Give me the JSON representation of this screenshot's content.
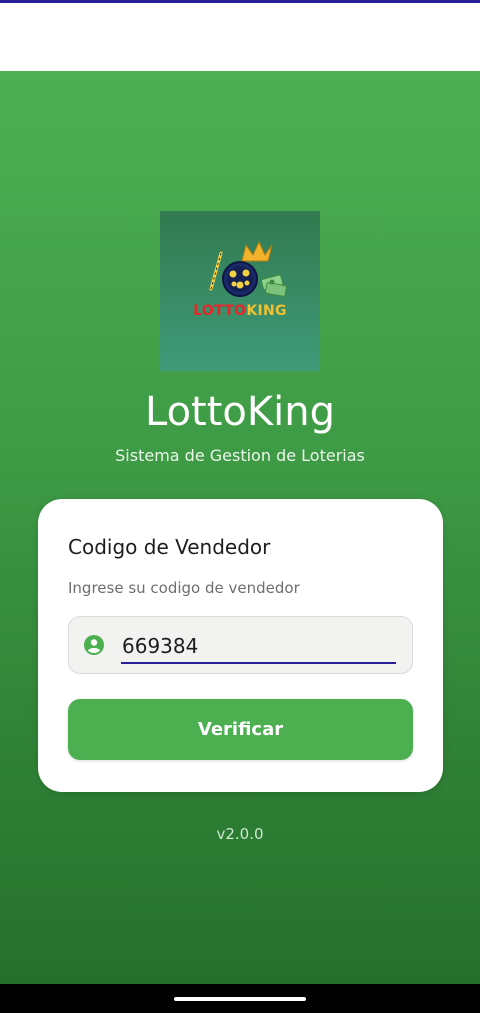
{
  "app": {
    "title": "LottoKing",
    "subtitle": "Sistema de Gestion de Loterias",
    "version": "v2.0.0"
  },
  "logo": {
    "word_lotto": "LOTTO",
    "word_king": "KING"
  },
  "card": {
    "title": "Codigo de Vendedor",
    "hint": "Ingrese su codigo de vendedor",
    "input_value": "669384",
    "user_icon": "account-circle-icon",
    "button_label": "Verificar"
  },
  "colors": {
    "primary": "#4caf50",
    "accent": "#2a1f9a",
    "logo_red": "#e8262a",
    "logo_gold": "#f2c230"
  }
}
